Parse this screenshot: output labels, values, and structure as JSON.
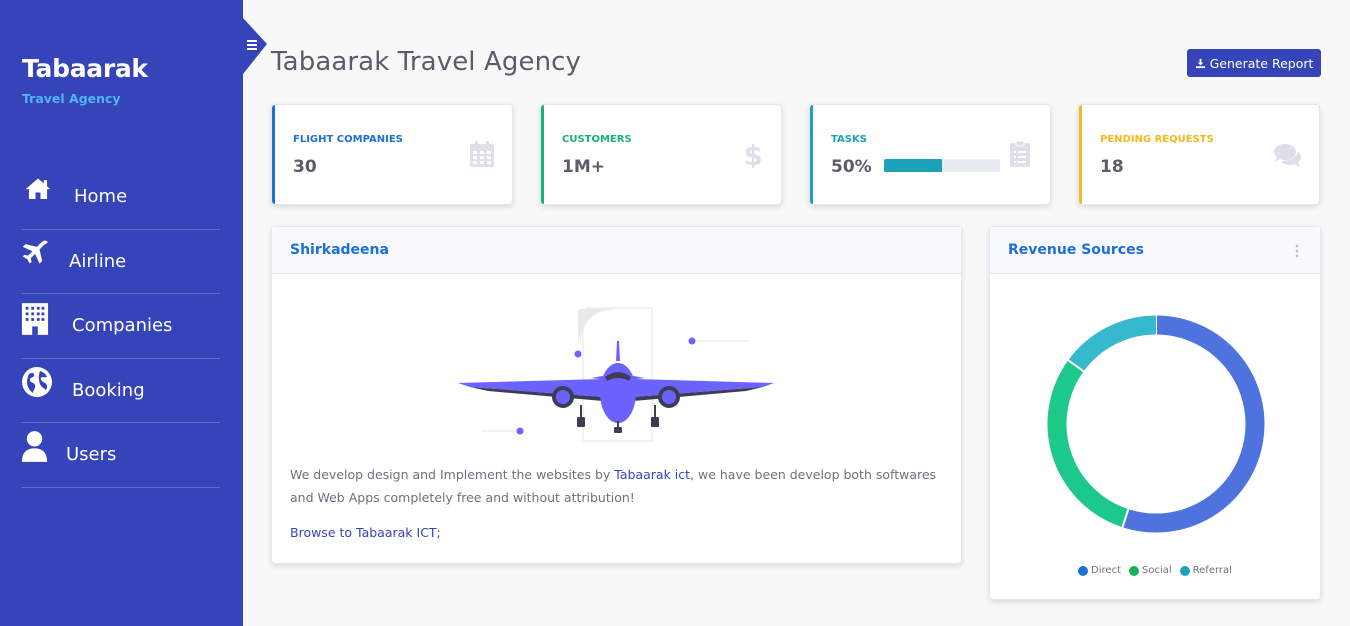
{
  "sidebar": {
    "brand_title": "Tabaarak",
    "brand_subtitle": "Travel Agency",
    "items": [
      {
        "label": "Home",
        "icon": "home-icon"
      },
      {
        "label": "Airline",
        "icon": "plane-icon"
      },
      {
        "label": "Companies",
        "icon": "building-icon"
      },
      {
        "label": "Booking",
        "icon": "globe-icon"
      },
      {
        "label": "Users",
        "icon": "user-icon"
      }
    ],
    "toggle_icon": "menu-icon"
  },
  "header": {
    "title": "Tabaarak Travel Agency",
    "report_button": "Generate Report",
    "report_icon": "download-icon"
  },
  "stats": [
    {
      "label": "Flight Companies",
      "value": "30",
      "color": "#1e6fd9",
      "icon": "calendar-icon"
    },
    {
      "label": "Customers",
      "value": "1M+",
      "color": "#1cb079",
      "icon": "dollar-icon"
    },
    {
      "label": "Tasks",
      "value": "50%",
      "color": "#1ba2b8",
      "icon": "clipboard-icon",
      "progress": 0.5
    },
    {
      "label": "Pending Requests",
      "value": "18",
      "color": "#f6b91a",
      "icon": "comments-icon"
    }
  ],
  "about_panel": {
    "title": "Shirkadeena",
    "illustration": "airplane-illustration",
    "text_before": "We develop design and Implement the websites by ",
    "link_text": "Tabaarak ict",
    "text_after": ", we have been develop both softwares and Web Apps completely free and without attribution!",
    "browse_link": "Browse to Tabaarak ICT;"
  },
  "revenue_panel": {
    "title": "Revenue Sources",
    "menu_icon": "more-vertical-icon",
    "legend": [
      {
        "label": "Direct",
        "color": "#1e6fd9"
      },
      {
        "label": "Social",
        "color": "#1cb05a"
      },
      {
        "label": "Referral",
        "color": "#1ba2b8"
      }
    ]
  },
  "chart_data": {
    "type": "pie",
    "categories": [
      "Direct",
      "Social",
      "Referral"
    ],
    "values": [
      55,
      30,
      15
    ],
    "colors": [
      "#4e73df",
      "#1cc88a",
      "#36b9cc"
    ],
    "title": "",
    "legend_position": "bottom"
  }
}
